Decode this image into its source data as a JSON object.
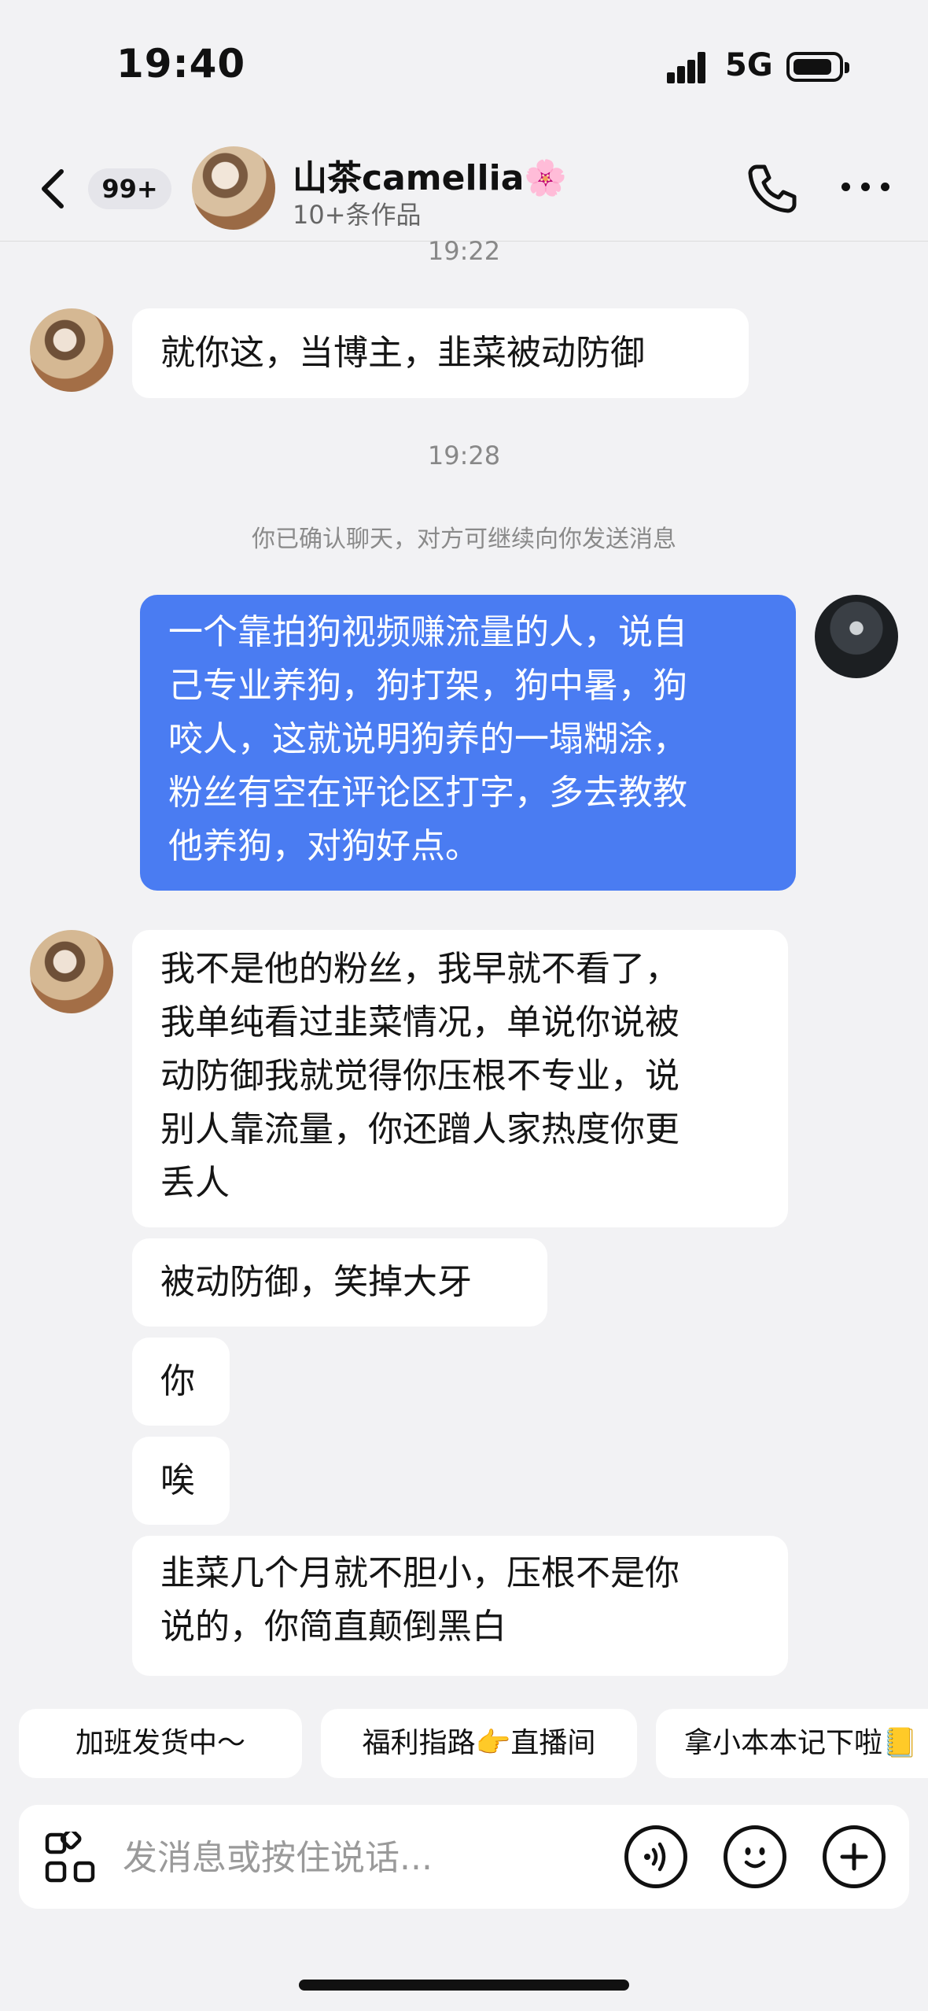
{
  "status_bar": {
    "time": "19:40",
    "network": "5G"
  },
  "header": {
    "unread_badge": "99+",
    "contact_name": "山茶camellia🌸",
    "contact_subtitle": "10+条作品"
  },
  "messages": {
    "timestamp_1": "19:22",
    "msg_1": "就你这，当博主，韭菜被动防御",
    "timestamp_2": "19:28",
    "system_notice": "你已确认聊天，对方可继续向你发送消息",
    "msg_2_line_1": "一个靠拍狗视频赚流量的人，说自",
    "msg_2_line_2": "己专业养狗，狗打架，狗中暑，狗",
    "msg_2_line_3": "咬人，这就说明狗养的一塌糊涂，",
    "msg_2_line_4": "粉丝有空在评论区打字，多去教教",
    "msg_2_line_5": "他养狗，对狗好点。",
    "msg_3_line_1": "我不是他的粉丝，我早就不看了，",
    "msg_3_line_2": "我单纯看过韭菜情况，单说你说被",
    "msg_3_line_3": "动防御我就觉得你压根不专业，说",
    "msg_3_line_4": "别人靠流量，你还蹭人家热度你更",
    "msg_3_line_5": "丢人",
    "msg_4": "被动防御，笑掉大牙",
    "msg_5": "你",
    "msg_6": "唉",
    "msg_7_line_1": "韭菜几个月就不胆小，压根不是你",
    "msg_7_line_2": "说的，你简直颠倒黑白"
  },
  "quick_replies": [
    "加班发货中～",
    "福利指路👉直播间",
    "拿小本本记下啦📒"
  ],
  "input": {
    "placeholder": "发消息或按住说话..."
  },
  "icons": {
    "back": "chevron-left-icon",
    "call": "phone-icon",
    "more": "more-icon",
    "apps": "apps-grid-icon",
    "voice": "voice-icon",
    "emoji": "emoji-icon",
    "add": "plus-icon"
  },
  "colors": {
    "outgoing_bubble": "#4a7cf2",
    "background": "#f2f2f4",
    "incoming_bubble": "#ffffff"
  }
}
